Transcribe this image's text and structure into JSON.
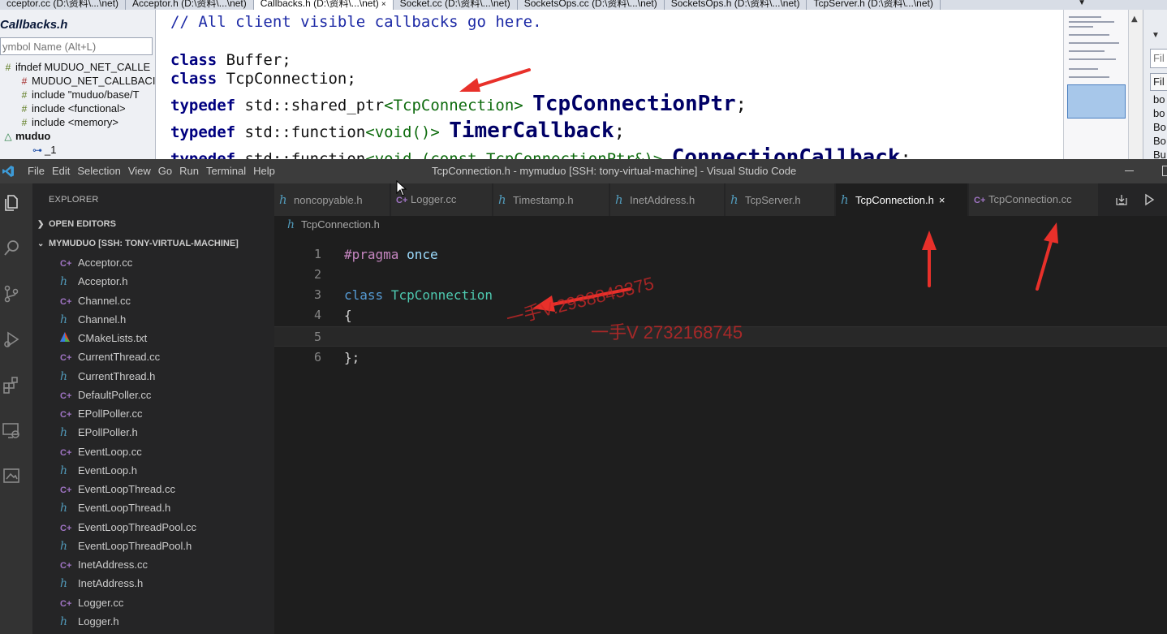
{
  "source_insight": {
    "tabs": [
      {
        "label": "cceptor.cc (D:\\资料\\...\\net)",
        "active": false
      },
      {
        "label": "Acceptor.h (D:\\资料\\...\\net)",
        "active": false
      },
      {
        "label": "Callbacks.h (D:\\资料\\...\\net)",
        "active": true,
        "close": "×"
      },
      {
        "label": "Socket.cc (D:\\资料\\...\\net)",
        "active": false
      },
      {
        "label": "SocketsOps.cc (D:\\资料\\...\\net)",
        "active": false
      },
      {
        "label": "SocketsOps.h (D:\\资料\\...\\net)",
        "active": false
      },
      {
        "label": "TcpServer.h (D:\\资料\\...\\net)",
        "active": false
      }
    ],
    "file_title": "Callbacks.h",
    "symbol_placeholder": "ymbol Name (Alt+L)",
    "symbols": [
      {
        "text": "ifndef MUDUO_NET_CALLE",
        "icon": "#",
        "icon_color": "#5c7a1e"
      },
      {
        "text": "MUDUO_NET_CALLBACI",
        "icon": "#",
        "icon_color": "#9e1b1b"
      },
      {
        "text": "include \"muduo/base/T",
        "icon": "#",
        "icon_color": "#5c7a1e"
      },
      {
        "text": "include <functional>",
        "icon": "#",
        "icon_color": "#5c7a1e"
      },
      {
        "text": "include <memory>",
        "icon": "#",
        "icon_color": "#5c7a1e"
      },
      {
        "text": "muduo",
        "icon": "△",
        "icon_color": "#1e7a3a"
      },
      {
        "text": "_1",
        "icon": "⊶",
        "icon_color": "#1f4fa8"
      }
    ],
    "code": {
      "comment": "// All client visible callbacks go here.",
      "class_kw": "class",
      "buffer": "Buffer;",
      "tcpconnection": "TcpConnection;",
      "typedef_kw": "typedef",
      "shared_ptr": "std::shared_ptr",
      "shared_ptr_arg": "<TcpConnection>",
      "ptr_name": "TcpConnectionPtr",
      "function": "std::function",
      "function_void": "<void()>",
      "timer_name": "TimerCallback",
      "semicolon": ";",
      "function_conn_arg": "<void (const TcpConnectionPtr&)>",
      "conn_name": "ConnectionCallback"
    },
    "right_panel": {
      "filter": "Fil",
      "header": "Fil",
      "items": [
        "bo",
        "bo",
        "Bo",
        "Bo",
        "Bu"
      ]
    }
  },
  "vscode": {
    "menu": [
      "File",
      "Edit",
      "Selection",
      "View",
      "Go",
      "Run",
      "Terminal",
      "Help"
    ],
    "window_title": "TcpConnection.h - mymuduo [SSH: tony-virtual-machine] - Visual Studio Code",
    "explorer_title": "EXPLORER",
    "open_editors": "OPEN EDITORS",
    "project": "MYMUDUO [SSH: TONY-VIRTUAL-MACHINE]",
    "files": [
      {
        "name": "Acceptor.cc",
        "type": "cpp"
      },
      {
        "name": "Acceptor.h",
        "type": "h"
      },
      {
        "name": "Channel.cc",
        "type": "cpp"
      },
      {
        "name": "Channel.h",
        "type": "h"
      },
      {
        "name": "CMakeLists.txt",
        "type": "cmake"
      },
      {
        "name": "CurrentThread.cc",
        "type": "cpp"
      },
      {
        "name": "CurrentThread.h",
        "type": "h"
      },
      {
        "name": "DefaultPoller.cc",
        "type": "cpp"
      },
      {
        "name": "EPollPoller.cc",
        "type": "cpp"
      },
      {
        "name": "EPollPoller.h",
        "type": "h"
      },
      {
        "name": "EventLoop.cc",
        "type": "cpp"
      },
      {
        "name": "EventLoop.h",
        "type": "h"
      },
      {
        "name": "EventLoopThread.cc",
        "type": "cpp"
      },
      {
        "name": "EventLoopThread.h",
        "type": "h"
      },
      {
        "name": "EventLoopThreadPool.cc",
        "type": "cpp"
      },
      {
        "name": "EventLoopThreadPool.h",
        "type": "h"
      },
      {
        "name": "InetAddress.cc",
        "type": "cpp"
      },
      {
        "name": "InetAddress.h",
        "type": "h"
      },
      {
        "name": "Logger.cc",
        "type": "cpp"
      },
      {
        "name": "Logger.h",
        "type": "h"
      }
    ],
    "tabs": [
      {
        "name": "noncopyable.h",
        "type": "h",
        "active": false
      },
      {
        "name": "Logger.cc",
        "type": "cpp",
        "active": false
      },
      {
        "name": "Timestamp.h",
        "type": "h",
        "active": false
      },
      {
        "name": "InetAddress.h",
        "type": "h",
        "active": false
      },
      {
        "name": "TcpServer.h",
        "type": "h",
        "active": false
      },
      {
        "name": "TcpConnection.h",
        "type": "h",
        "active": true
      },
      {
        "name": "TcpConnection.cc",
        "type": "cpp",
        "active": false
      }
    ],
    "tab_close": "×",
    "breadcrumb": "TcpConnection.h",
    "icon_glyphs": {
      "h": "h",
      "cpp": "C+",
      "cmake": "▲"
    },
    "code": {
      "line_numbers": [
        "1",
        "2",
        "3",
        "4",
        "5",
        "6"
      ],
      "pragma": "#pragma",
      "once": "once",
      "class_kw": "class",
      "class_name": "TcpConnection",
      "open_brace": "{",
      "close_brace": "};"
    }
  },
  "watermarks": [
    "一手V:2938843375",
    "一手V 2732168745"
  ],
  "colors": {
    "activity_bar": "#333333",
    "sidebar": "#252526",
    "editor": "#1e1e1e",
    "titlebar": "#3c3c3c",
    "annotation_red": "#e8302a"
  }
}
